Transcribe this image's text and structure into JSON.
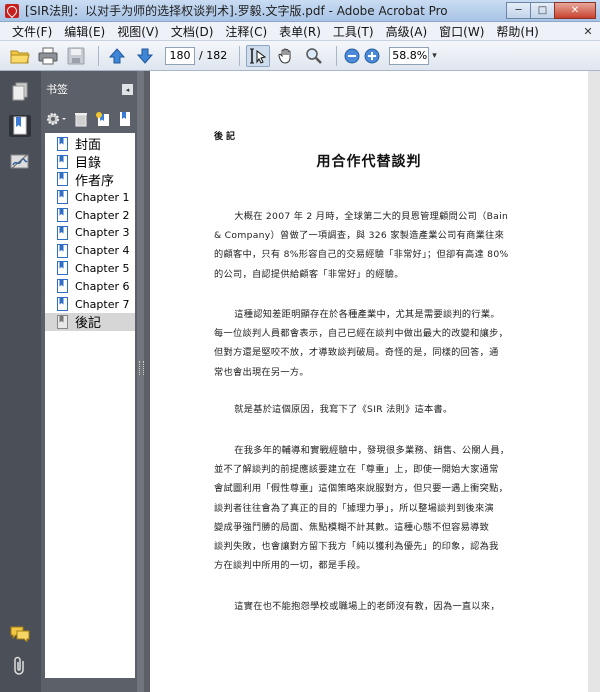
{
  "window": {
    "title": "[SIR法則：以对手为师的选择权谈判术].罗毅.文字版.pdf - Adobe Acrobat Pro",
    "minimize": "─",
    "maximize": "□",
    "close": "✕"
  },
  "menu": [
    "文件(F)",
    "编辑(E)",
    "视图(V)",
    "文档(D)",
    "注释(C)",
    "表单(R)",
    "工具(T)",
    "高级(A)",
    "窗口(W)",
    "帮助(H)"
  ],
  "menu_close": "✕",
  "toolbar": {
    "current_page": "180",
    "total_pages": "/ 182",
    "zoom": "58.8%"
  },
  "bookmarks_panel": {
    "title": "书签",
    "collapse": "◂",
    "items": [
      {
        "label": "封面"
      },
      {
        "label": "目錄"
      },
      {
        "label": "作者序"
      },
      {
        "label": "Chapter 1"
      },
      {
        "label": "Chapter 2"
      },
      {
        "label": "Chapter 3"
      },
      {
        "label": "Chapter 4"
      },
      {
        "label": "Chapter 5"
      },
      {
        "label": "Chapter 6"
      },
      {
        "label": "Chapter 7"
      },
      {
        "label": "後記"
      }
    ]
  },
  "document": {
    "section_label": "後記",
    "title": "用合作代替談判",
    "paragraphs": [
      [
        "大概在 2007 年 2 月時，全球第二大的貝恩管理顧問公司（Bain",
        "& Company）曾做了一項調查，與 326 家製造產業公司有商業往來",
        "的顧客中，只有 8%形容自己的交易經驗「非常好」；但卻有高達 80%",
        "的公司，自認提供給顧客「非常好」的經驗。"
      ],
      [
        "這種認知差距明顯存在於各種產業中，尤其是需要談判的行業。",
        "每一位談判人員都會表示，自己已經在談判中做出最大的改變和讓步，",
        "但對方還是堅咬不放，才導致談判破局。奇怪的是，同樣的回答，通",
        "常也會出現在另一方。"
      ],
      [
        "就是基於這個原因，我寫下了《SIR 法則》這本書。"
      ],
      [
        "在我多年的輔導和實戰經驗中，發現很多業務、銷售、公關人員，",
        "並不了解談判的前提應該要建立在「尊重」上，即使一開始大家通常",
        "會試圖利用「假性尊重」這個策略來說服對方，但只要一遇上衝突點，",
        "談判者往往會為了真正的目的「據理力爭」，所以整場談判到後來演",
        "變成爭強鬥勝的局面、焦點模糊不計其數。這種心態不但容易導致",
        "談判失敗，也會讓對方留下我方「純以獲利為優先」的印象，認為我",
        "方在談判中所用的一切，都是手段。"
      ],
      [
        "這實在也不能抱怨學校或職場上的老師沒有教，因為一直以來，"
      ]
    ]
  }
}
